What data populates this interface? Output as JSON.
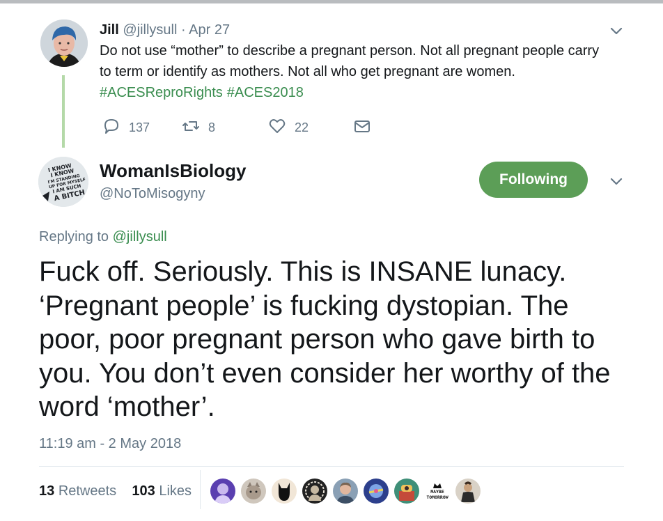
{
  "parent_tweet": {
    "author_name": "Jill",
    "author_handle": "@jillysull",
    "separator": "·",
    "date": "Apr 27",
    "text": "Do not use “mother” to describe a pregnant person. Not all pregnant people carry to term or identify as mothers. Not all who get pregnant are women.",
    "hashtags": [
      "#ACESReproRights",
      "#ACES2018"
    ],
    "reply_count": "137",
    "retweet_count": "8",
    "like_count": "22",
    "icons": {
      "reply": "reply-icon",
      "retweet": "retweet-icon",
      "like": "heart-icon",
      "dm": "envelope-icon",
      "menu": "chevron-down-icon"
    }
  },
  "main_tweet": {
    "author_name": "WomanIsBiology",
    "author_handle": "@NoToMisogyny",
    "avatar_text": [
      "I KNOW",
      "I KNOW",
      "I'M STANDING",
      "UP FOR MYSELF",
      "I AM SUCH",
      "A BITCH"
    ],
    "follow_label": "Following",
    "replying_label": "Replying to",
    "replying_handle": "@jillysull",
    "text": "Fuck off. Seriously. This is INSANE lunacy. ‘Pregnant people’ is fucking dystopian. The poor, poor pregnant person who gave birth to you. You don’t even consider her worthy of the word ‘mother’.",
    "timestamp": "11:19 am - 2 May 2018",
    "retweets_count": "13",
    "retweets_label": "Retweets",
    "likes_count": "103",
    "likes_label": "Likes",
    "liker_badge": [
      "MAYBE",
      "TOMORROW"
    ]
  },
  "colors": {
    "accent_green": "#3a8d4f",
    "follow_button": "#5c9e57",
    "thread_line": "#b4d9a8",
    "muted": "#657786"
  }
}
